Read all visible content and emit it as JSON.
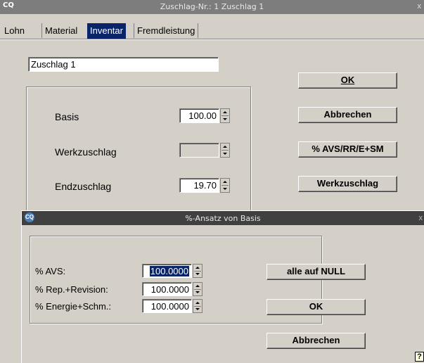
{
  "window": {
    "app_icon": "CQ",
    "title": "Zuschlag-Nr.: 1 Zuschlag 1",
    "close": "x"
  },
  "tabs": [
    "Lohn",
    "Material",
    "Inventar",
    "Fremdleistung"
  ],
  "active_tab": "Inventar",
  "name_field": {
    "value": "Zuschlag 1"
  },
  "fields": {
    "basis": {
      "label": "Basis",
      "value": "100.00"
    },
    "werkzuschlag": {
      "label": "Werkzuschlag",
      "value": ""
    },
    "endzuschlag": {
      "label": "Endzuschlag",
      "value": "19.70"
    }
  },
  "buttons": {
    "ok": "OK",
    "abbrechen": "Abbrechen",
    "avs": "% AVS/RR/E+SM",
    "werkzuschlag": "Werkzuschlag"
  },
  "dialog": {
    "app_icon": "CQ",
    "title": "%-Ansatz von Basis",
    "close": "x",
    "fields": [
      {
        "label": "% AVS:",
        "value": "100.0000"
      },
      {
        "label": "% Rep.+Revision:",
        "value": "100.0000"
      },
      {
        "label": "% Energie+Schm.:",
        "value": "100.0000"
      }
    ],
    "buttons": {
      "alle_auf_null": "alle auf NULL",
      "ok": "OK",
      "abbrechen": "Abbrechen"
    },
    "help": "?"
  },
  "colors": {
    "window_bg": "#d4d0c8",
    "active_tab": "#0a246a",
    "title_bar": "#7d7d7d",
    "dialog_title_bar": "#404040",
    "selection": "#0a246a"
  }
}
